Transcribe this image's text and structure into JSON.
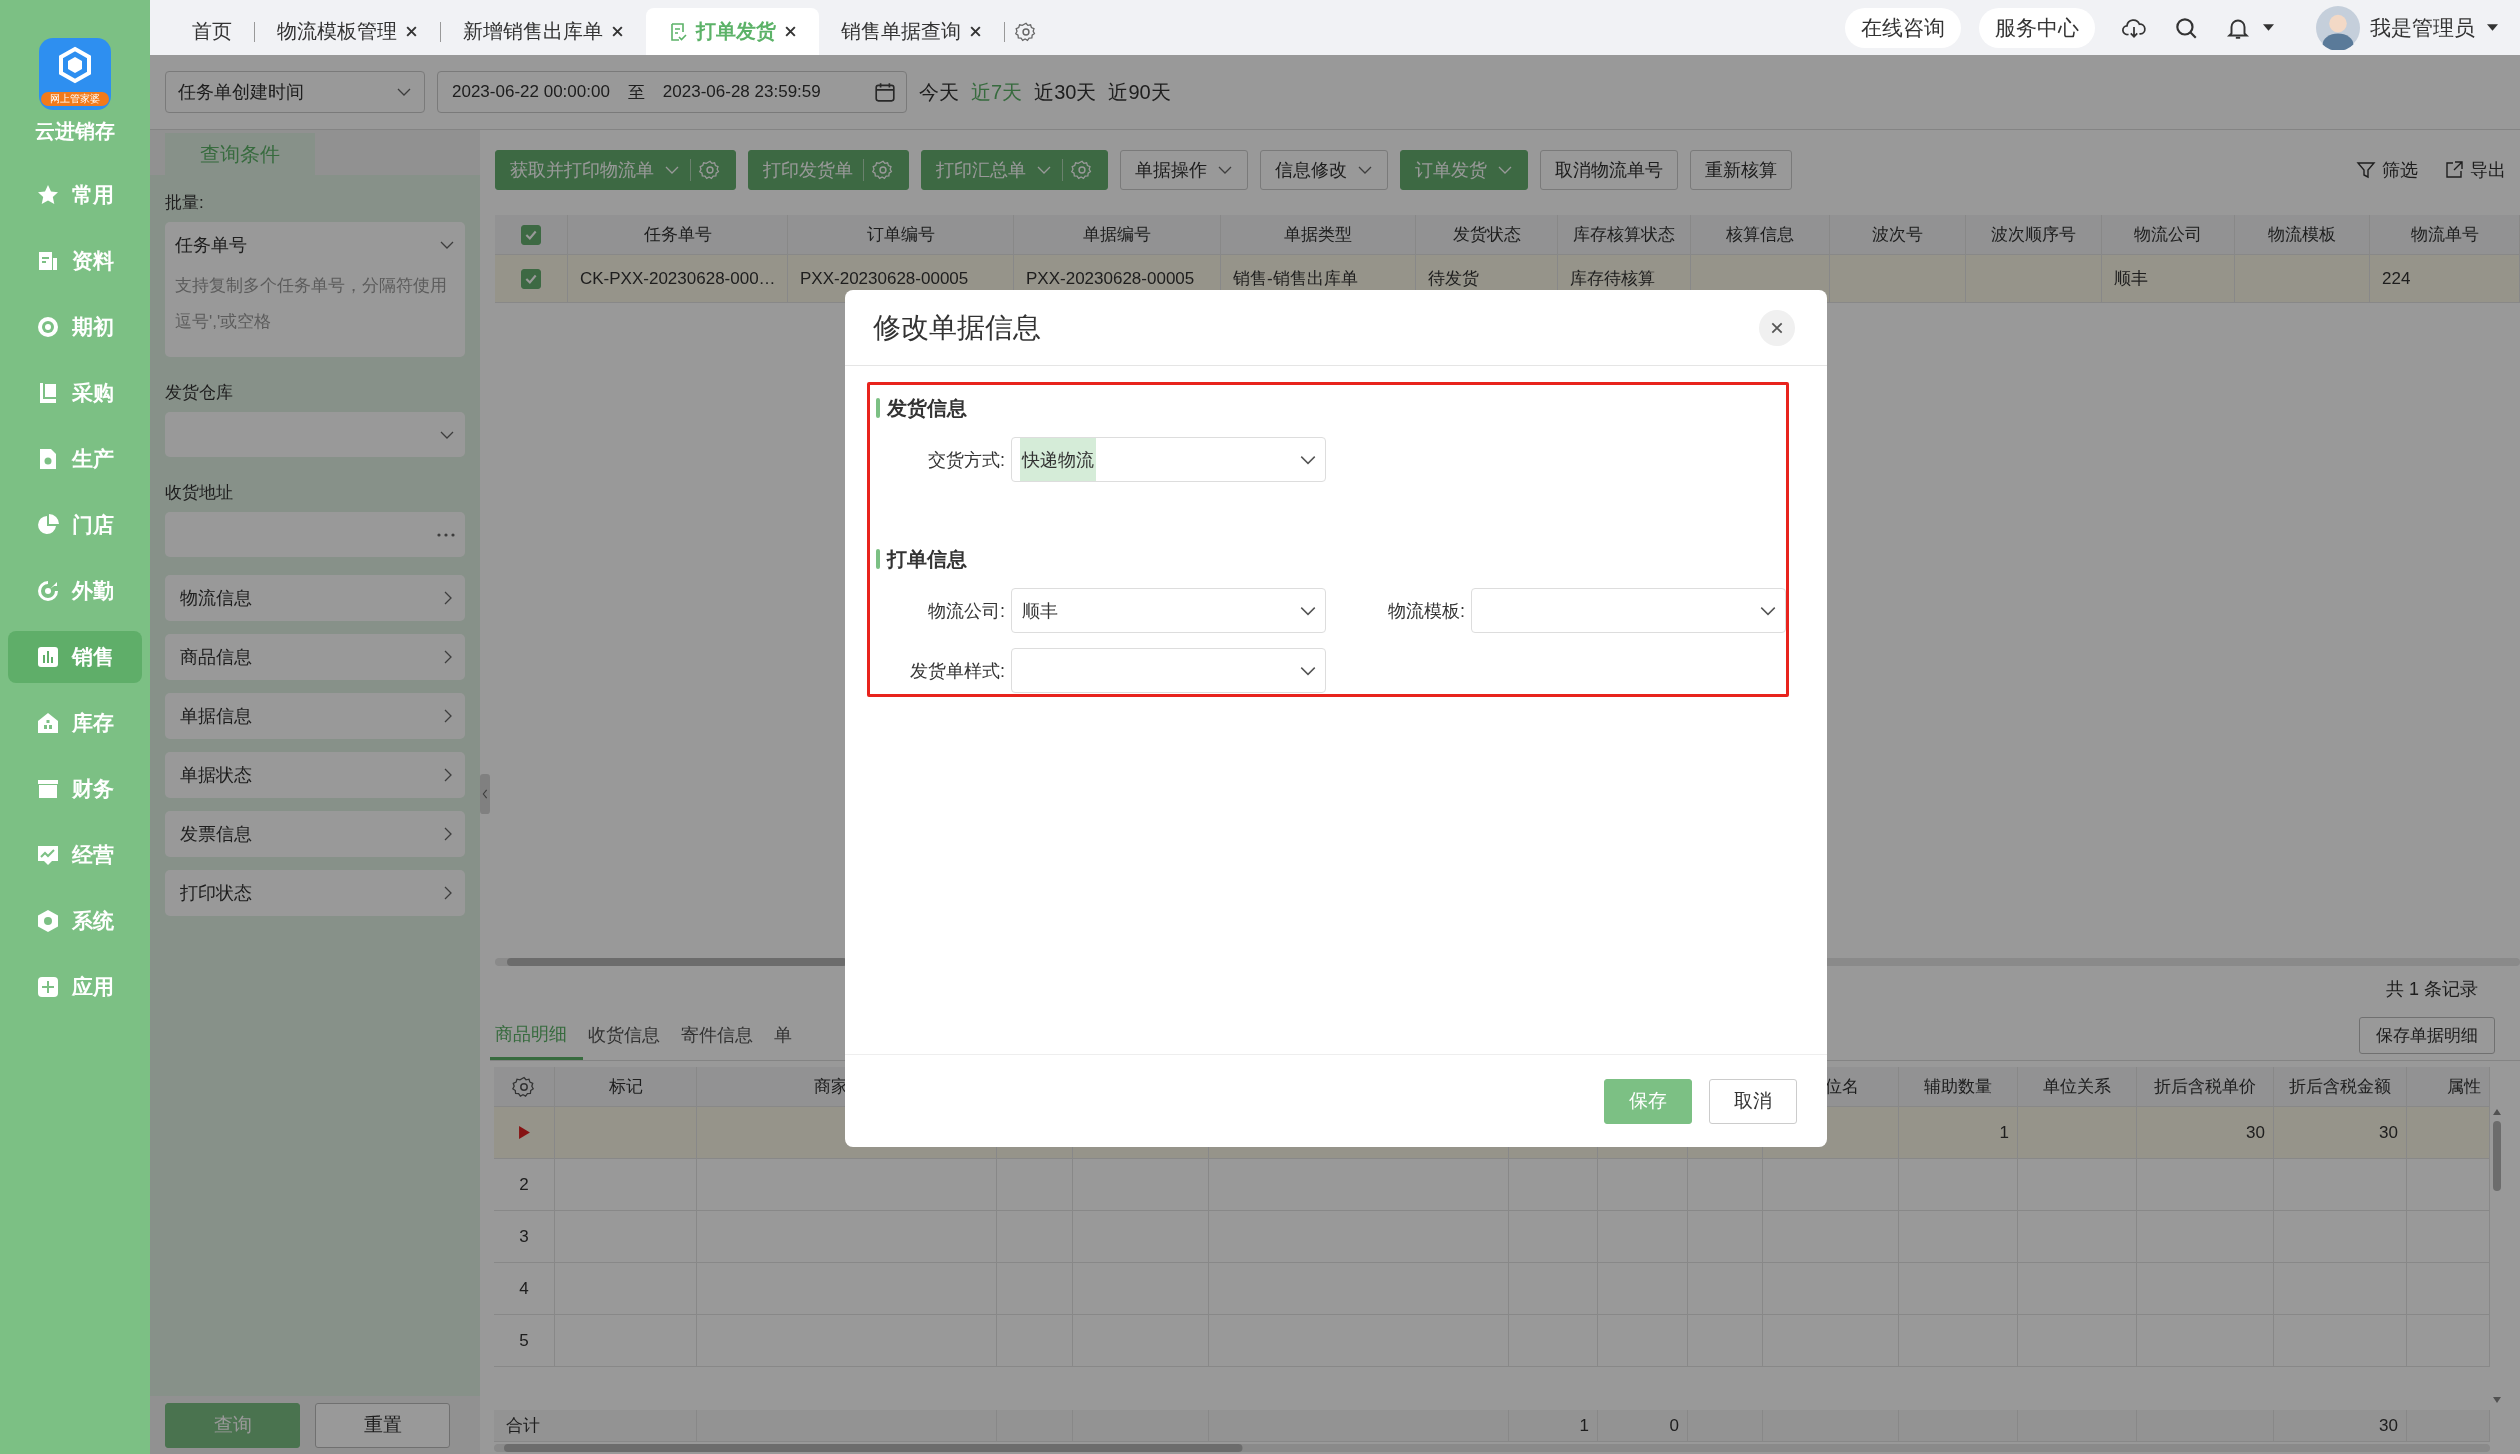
{
  "sidebar": {
    "logo_badge": "网上管家婆",
    "app_name": "云进销存",
    "items": [
      {
        "label": "常用",
        "selected": false
      },
      {
        "label": "资料",
        "selected": false
      },
      {
        "label": "期初",
        "selected": false
      },
      {
        "label": "采购",
        "selected": false
      },
      {
        "label": "生产",
        "selected": false
      },
      {
        "label": "门店",
        "selected": false
      },
      {
        "label": "外勤",
        "selected": false
      },
      {
        "label": "销售",
        "selected": true
      },
      {
        "label": "库存",
        "selected": false
      },
      {
        "label": "财务",
        "selected": false
      },
      {
        "label": "经营",
        "selected": false
      },
      {
        "label": "系统",
        "selected": false
      },
      {
        "label": "应用",
        "selected": false
      }
    ]
  },
  "tabs": [
    {
      "label": "首页",
      "selected": false,
      "closable": false
    },
    {
      "label": "物流模板管理",
      "selected": false,
      "closable": true
    },
    {
      "label": "新增销售出库单",
      "selected": false,
      "closable": true
    },
    {
      "label": "打单发货",
      "selected": true,
      "closable": true
    },
    {
      "label": "销售单据查询",
      "selected": false,
      "closable": true
    }
  ],
  "header_links": [
    "在线咨询",
    "服务中心"
  ],
  "user": {
    "name": "我是管理员"
  },
  "date_filter": {
    "field": "任务单创建时间",
    "start": "2023-06-22 00:00:00",
    "separator": "至",
    "end": "2023-06-28 23:59:59",
    "ranges": [
      {
        "label": "今天",
        "selected": false
      },
      {
        "label": "近7天",
        "selected": true
      },
      {
        "label": "近30天",
        "selected": false
      },
      {
        "label": "近90天",
        "selected": false
      }
    ]
  },
  "query_panel": {
    "tab": "查询条件",
    "batch_label": "批量:",
    "batch_type": "任务单号",
    "batch_placeholder": "支持复制多个任务单号，分隔符使用逗号','或空格",
    "warehouse_label": "发货仓库",
    "address_label": "收货地址",
    "groups": [
      "物流信息",
      "商品信息",
      "单据信息",
      "单据状态",
      "发票信息",
      "打印状态"
    ],
    "buttons": [
      {
        "label": "查询",
        "primary": true
      },
      {
        "label": "重置",
        "primary": false
      }
    ]
  },
  "toolbar": {
    "buttons": [
      {
        "label": "获取并打印物流单",
        "primary": true,
        "dropdown": true,
        "settings": true
      },
      {
        "label": "打印发货单",
        "primary": true,
        "dropdown": false,
        "settings": true
      },
      {
        "label": "打印汇总单",
        "primary": true,
        "dropdown": true,
        "settings": true
      },
      {
        "label": "单据操作",
        "primary": false,
        "dropdown": true,
        "settings": false
      },
      {
        "label": "信息修改",
        "primary": false,
        "dropdown": true,
        "settings": false
      },
      {
        "label": "订单发货",
        "primary": true,
        "dropdown": true,
        "settings": false
      },
      {
        "label": "取消物流单号",
        "primary": false,
        "dropdown": false,
        "settings": false
      },
      {
        "label": "重新核算",
        "primary": false,
        "dropdown": false,
        "settings": false
      }
    ],
    "filter": "筛选",
    "export": "导出"
  },
  "orders_table": {
    "all_checked": true,
    "columns": [
      "任务单号",
      "订单编号",
      "单据编号",
      "单据类型",
      "发货状态",
      "库存核算状态",
      "核算信息",
      "波次号",
      "波次顺序号",
      "物流公司",
      "物流模板",
      "物流单号"
    ],
    "rows": [
      {
        "checked": true,
        "cells": [
          "CK-PXX-20230628-000…",
          "PXX-20230628-00005",
          "PXX-20230628-00005",
          "销售-销售出库单",
          "待发货",
          "库存待核算",
          null,
          null,
          null,
          "顺丰",
          null,
          "224"
        ]
      }
    ]
  },
  "record_count": "共 1 条记录",
  "detail_tabs": [
    {
      "label": "商品明细",
      "selected": true
    },
    {
      "label": "收货信息",
      "selected": false
    },
    {
      "label": "寄件信息",
      "selected": false
    },
    {
      "label": "单",
      "selected": false
    }
  ],
  "save_detail": "保存单据明细",
  "detail_table": {
    "columns": [
      "标记",
      "商家",
      null,
      null,
      null,
      null,
      null,
      null,
      "位名",
      "辅助数量",
      "单位关系",
      "折后含税单价",
      "折后含税金额",
      "属性"
    ],
    "rows": [
      {
        "current": true,
        "cells": [
          null,
          null,
          null,
          null,
          null,
          null,
          null,
          null,
          null,
          "1",
          null,
          "30",
          "30",
          null
        ]
      },
      {
        "current": false,
        "number": "2"
      },
      {
        "current": false,
        "number": "3"
      },
      {
        "current": false,
        "number": "4"
      },
      {
        "current": false,
        "number": "5"
      }
    ],
    "totals": {
      "label": "合计",
      "cells": [
        null,
        null,
        null,
        null,
        null,
        "1",
        "0",
        null,
        null,
        null,
        null,
        null,
        "30",
        null
      ]
    }
  },
  "dialog": {
    "title": "修改单据信息",
    "sections": [
      {
        "title": "发货信息",
        "fields": [
          {
            "label": "交货方式:",
            "value": "快递物流",
            "highlighted": true
          }
        ]
      },
      {
        "title": "打单信息",
        "fields": [
          {
            "label": "物流公司:",
            "value": "顺丰",
            "highlighted": false
          },
          {
            "label": "物流模板:"
          },
          {
            "label": "发货单样式:"
          }
        ]
      }
    ],
    "buttons": [
      {
        "label": "保存",
        "primary": true
      },
      {
        "label": "取消",
        "primary": false
      }
    ]
  }
}
